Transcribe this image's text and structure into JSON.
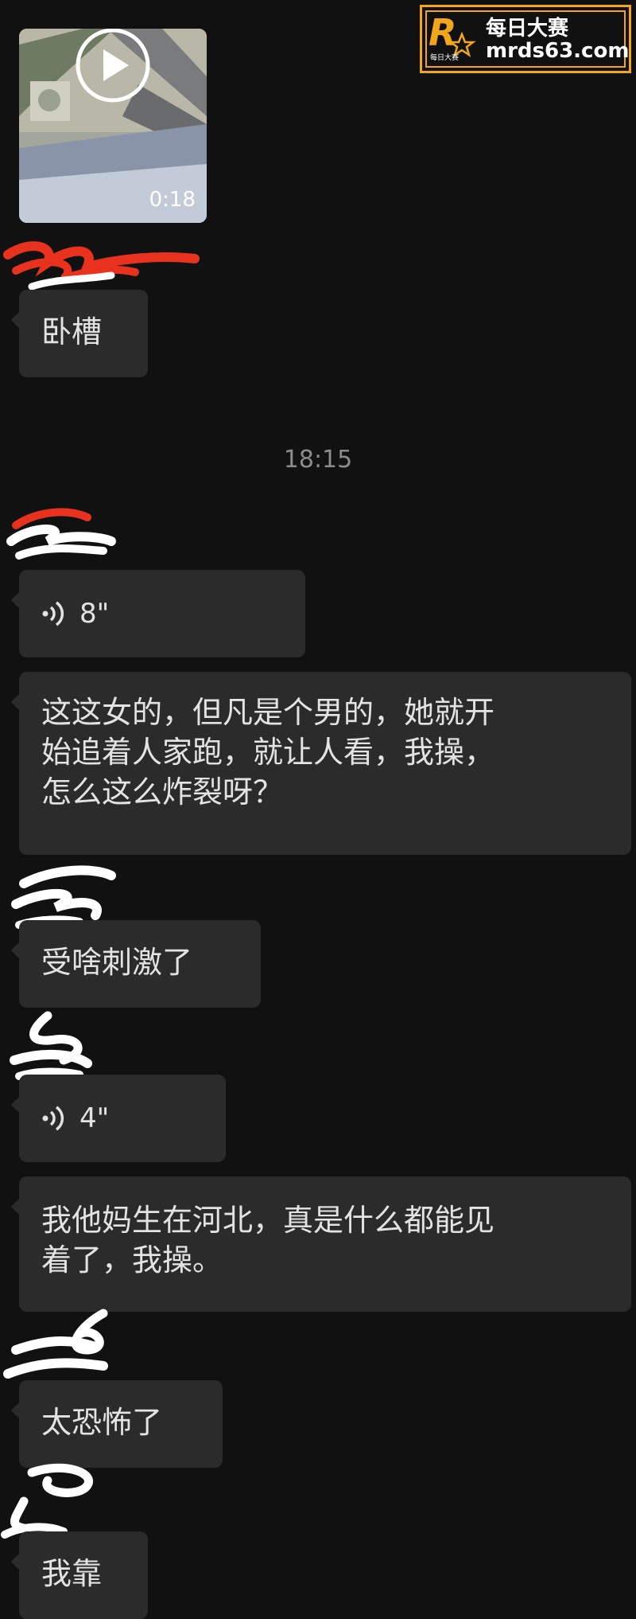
{
  "watermark": {
    "brand_title": "每日大赛",
    "site": "mrds63.com",
    "mark_letter": "R",
    "mark_sub": "每日大赛",
    "accent_color": "#f2a61c"
  },
  "video": {
    "duration": "0:18",
    "play_icon": "play-icon"
  },
  "timestamp": "18:15",
  "messages": [
    {
      "type": "text",
      "text": "卧槽"
    },
    {
      "type": "voice",
      "duration": "8\""
    },
    {
      "type": "text",
      "line1": "这这女的，但凡是个男的，她就开",
      "line2": "始追着人家跑，就让人看，我操，",
      "line3": "怎么这么炸裂呀？"
    },
    {
      "type": "text",
      "text": "受啥刺激了"
    },
    {
      "type": "voice",
      "duration": "4\""
    },
    {
      "type": "text",
      "line1": "我他妈生在河北，真是什么都能见",
      "line2": "着了，我操。"
    },
    {
      "type": "text",
      "text": "太恐怖了"
    },
    {
      "type": "text",
      "text": "我靠"
    }
  ],
  "colors": {
    "background": "#111111",
    "bubble": "#2b2b2b",
    "text": "#e3e3e3",
    "timestamp": "#8c8c8c",
    "redaction_red": "#e8321e",
    "redaction_white": "#ffffff"
  }
}
